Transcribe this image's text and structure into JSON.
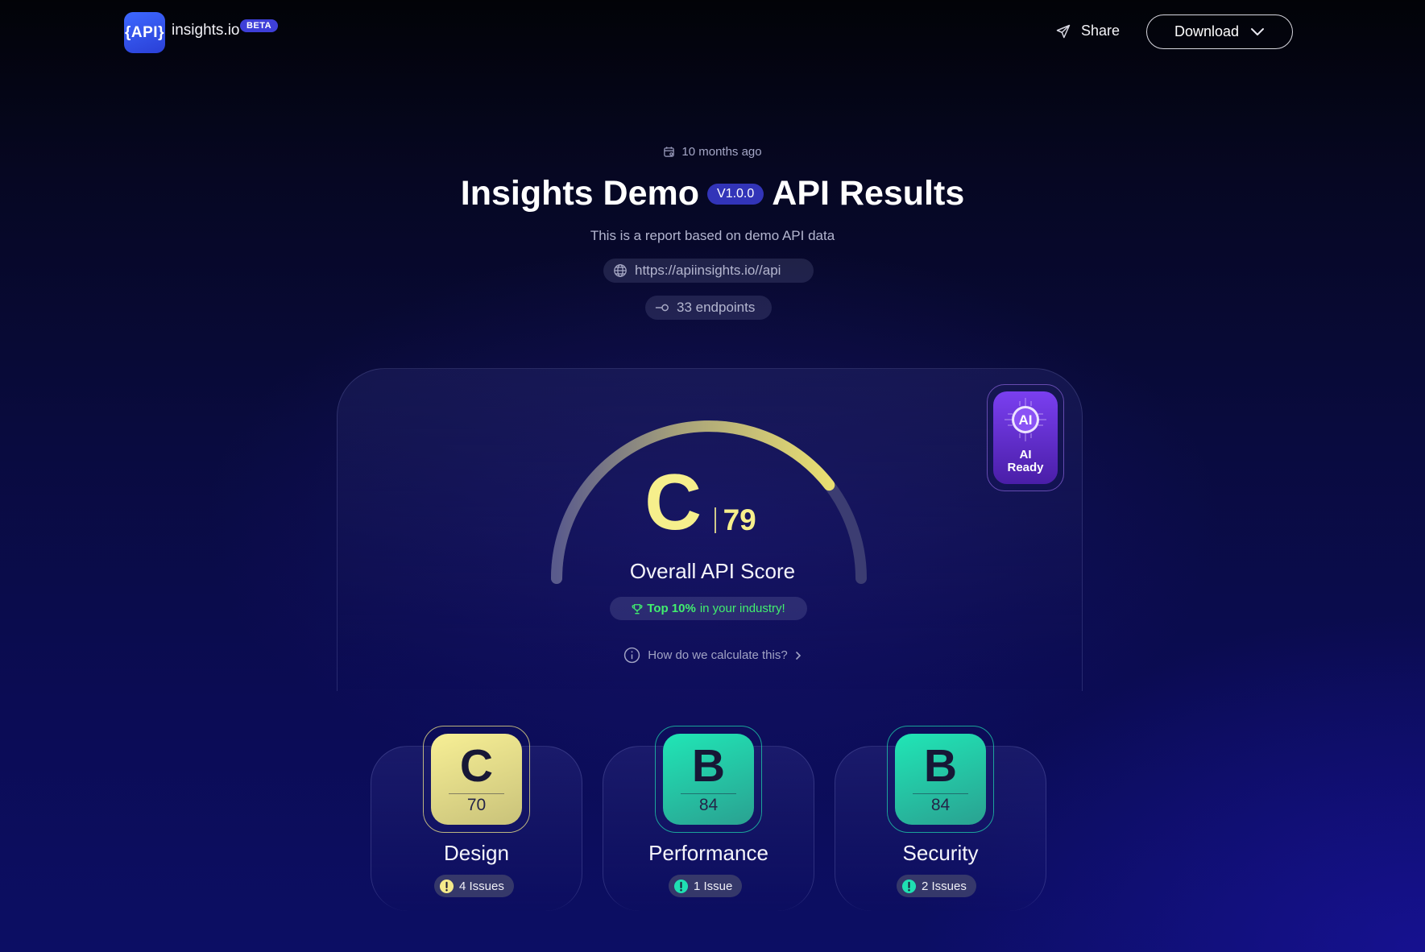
{
  "header": {
    "logo_text": "{API}",
    "brand": "insights.io",
    "beta_label": "BETA",
    "share_label": "Share",
    "download_label": "Download"
  },
  "report": {
    "updated": "10 months ago",
    "title_left": "Insights Demo",
    "version": "V1.0.0",
    "title_right": "API Results",
    "subtitle": "This is a report based on demo API data",
    "url": "https://apiinsights.io//api",
    "endpoints": "33 endpoints"
  },
  "score": {
    "grade": "C",
    "value": "79",
    "value_fraction": 0.79,
    "label": "Overall API Score",
    "top_bold": "Top 10%",
    "top_rest": " in your industry!",
    "calc_link": "How do we calculate this?",
    "ai_badge_icon_text": "AI",
    "ai_badge_label_1": "AI",
    "ai_badge_label_2": "Ready"
  },
  "categories": [
    {
      "grade": "C",
      "score": "70",
      "name": "Design",
      "issues": "4 Issues",
      "color": "#f4ea8a"
    },
    {
      "grade": "B",
      "score": "84",
      "name": "Performance",
      "issues": "1 Issue",
      "color": "#1fe0b2"
    },
    {
      "grade": "B",
      "score": "84",
      "name": "Security",
      "issues": "2 Issues",
      "color": "#1fe0b2"
    }
  ],
  "colors": {
    "accent": "#3e3fd8",
    "grade_c": "#f6ef8c",
    "grade_b": "#13e2b0",
    "success": "#41f06e",
    "ai": "#7a3ff0"
  }
}
